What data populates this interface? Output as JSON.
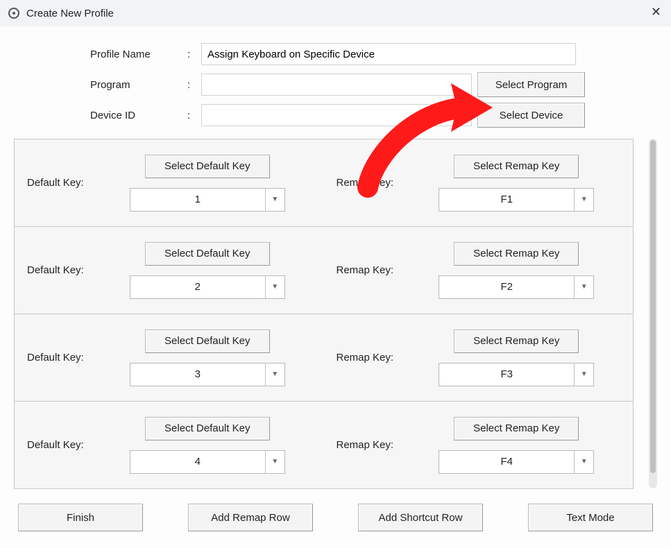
{
  "window": {
    "title": "Create New Profile"
  },
  "form": {
    "profile_name_label": "Profile Name",
    "profile_name_value": "Assign Keyboard on Specific Device",
    "program_label": "Program",
    "program_value": "",
    "select_program_btn": "Select Program",
    "device_id_label": "Device ID",
    "device_id_value": "",
    "select_device_btn": "Select Device"
  },
  "row_labels": {
    "default_key": "Default Key:",
    "remap_key": "Remap Key:",
    "select_default_btn": "Select Default Key",
    "select_remap_btn": "Select Remap Key"
  },
  "rows": [
    {
      "default_value": "1",
      "remap_value": "F1"
    },
    {
      "default_value": "2",
      "remap_value": "F2"
    },
    {
      "default_value": "3",
      "remap_value": "F3"
    },
    {
      "default_value": "4",
      "remap_value": "F4"
    }
  ],
  "footer": {
    "finish": "Finish",
    "add_remap": "Add Remap Row",
    "add_shortcut": "Add Shortcut Row",
    "text_mode": "Text Mode"
  },
  "annotation": {
    "arrow_color": "#ff0000"
  }
}
